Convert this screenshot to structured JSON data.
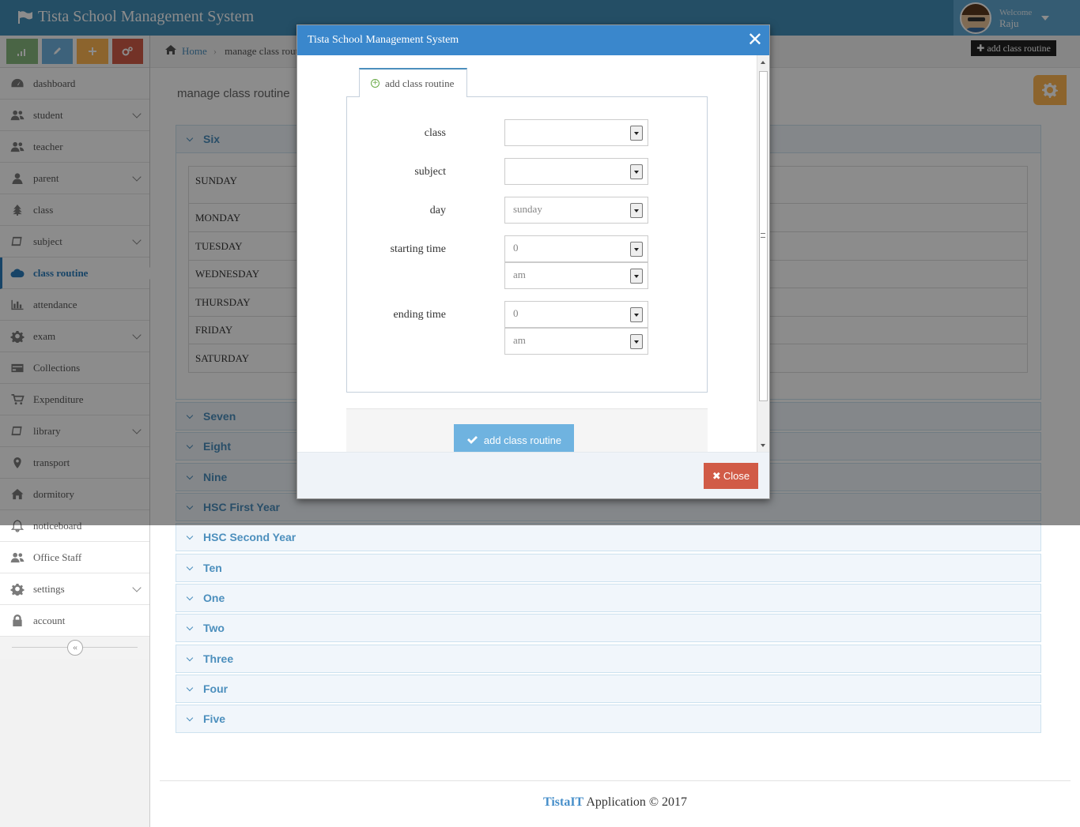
{
  "app": {
    "title": "Tista School Management System"
  },
  "user": {
    "welcome": "Welcome",
    "name": "Raju"
  },
  "sidebar": {
    "items": [
      {
        "label": "dashboard",
        "icon": "dashboard-icon",
        "chevron": false
      },
      {
        "label": "student",
        "icon": "users-icon",
        "chevron": true
      },
      {
        "label": "teacher",
        "icon": "users-icon",
        "chevron": false
      },
      {
        "label": "parent",
        "icon": "user-icon",
        "chevron": true
      },
      {
        "label": "class",
        "icon": "tree-icon",
        "chevron": false
      },
      {
        "label": "subject",
        "icon": "book-icon",
        "chevron": true
      },
      {
        "label": "class routine",
        "icon": "cloud-icon",
        "chevron": false,
        "active": true
      },
      {
        "label": "attendance",
        "icon": "bar-chart-icon",
        "chevron": false
      },
      {
        "label": "exam",
        "icon": "cog-icon",
        "chevron": true
      },
      {
        "label": "Collections",
        "icon": "credit-card-icon",
        "chevron": false
      },
      {
        "label": "Expenditure",
        "icon": "cart-icon",
        "chevron": false
      },
      {
        "label": "library",
        "icon": "book-icon",
        "chevron": true
      },
      {
        "label": "transport",
        "icon": "map-marker-icon",
        "chevron": false
      },
      {
        "label": "dormitory",
        "icon": "home-icon",
        "chevron": false
      },
      {
        "label": "noticeboard",
        "icon": "bell-icon",
        "chevron": false
      },
      {
        "label": "Office Staff",
        "icon": "users-icon",
        "chevron": false
      },
      {
        "label": "settings",
        "icon": "cog-icon",
        "chevron": true
      },
      {
        "label": "account",
        "icon": "lock-icon",
        "chevron": false
      }
    ]
  },
  "breadcrumb": {
    "home": "Home",
    "current": "manage class routine"
  },
  "top_button": {
    "label": "add class routine"
  },
  "page": {
    "title": "manage class routine"
  },
  "classes": [
    {
      "name": "Six"
    },
    {
      "name": "Seven"
    },
    {
      "name": "Eight"
    },
    {
      "name": "Nine"
    },
    {
      "name": "HSC First Year"
    },
    {
      "name": "HSC Second Year"
    },
    {
      "name": "Ten"
    },
    {
      "name": "One"
    },
    {
      "name": "Two"
    },
    {
      "name": "Three"
    },
    {
      "name": "Four"
    },
    {
      "name": "Five"
    }
  ],
  "days": [
    "SUNDAY",
    "MONDAY",
    "TUESDAY",
    "WEDNESDAY",
    "THURSDAY",
    "FRIDAY",
    "SATURDAY"
  ],
  "footer": {
    "brand": "TistaIT",
    "text": "Application © 2017"
  },
  "modal": {
    "title": "Tista School Management System",
    "tab_label": "add class routine",
    "fields": {
      "class_label": "class",
      "class_value": "",
      "subject_label": "subject",
      "subject_value": "",
      "day_label": "day",
      "day_value": "sunday",
      "start_label": "starting time",
      "start_hour": "0",
      "start_ampm": "am",
      "end_label": "ending time",
      "end_hour": "0",
      "end_ampm": "am"
    },
    "submit_label": "add class routine",
    "close_label": "Close"
  },
  "colors": {
    "navbar": "#438eb9",
    "accent": "#4c8fbd",
    "danger": "#d15b47",
    "warning": "#ffb752",
    "success": "#87b87f",
    "info": "#6fb3e0"
  }
}
